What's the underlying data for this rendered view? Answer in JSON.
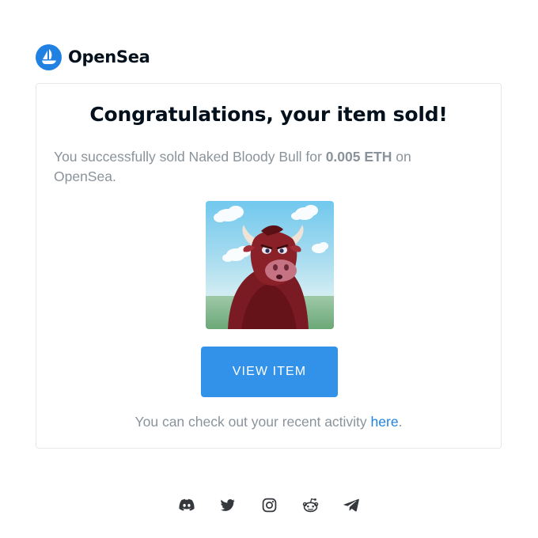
{
  "brand": {
    "name": "OpenSea",
    "logo_icon": "sailboat-icon",
    "color": "#2081e2"
  },
  "card": {
    "title": "Congratulations, your item sold!",
    "message_prefix": "You successfully sold Naked Bloody Bull for ",
    "price": "0.005 ETH",
    "message_suffix": " on OpenSea.",
    "image_alt": "Naked Bloody Bull",
    "button_label": "VIEW ITEM",
    "button_color": "#3291e9",
    "activity_prefix": "You can check out your recent activity ",
    "activity_link": "here",
    "activity_suffix": "."
  },
  "footer": {
    "socials": [
      {
        "name": "discord-icon"
      },
      {
        "name": "twitter-icon"
      },
      {
        "name": "instagram-icon"
      },
      {
        "name": "reddit-icon"
      },
      {
        "name": "telegram-icon"
      }
    ]
  }
}
